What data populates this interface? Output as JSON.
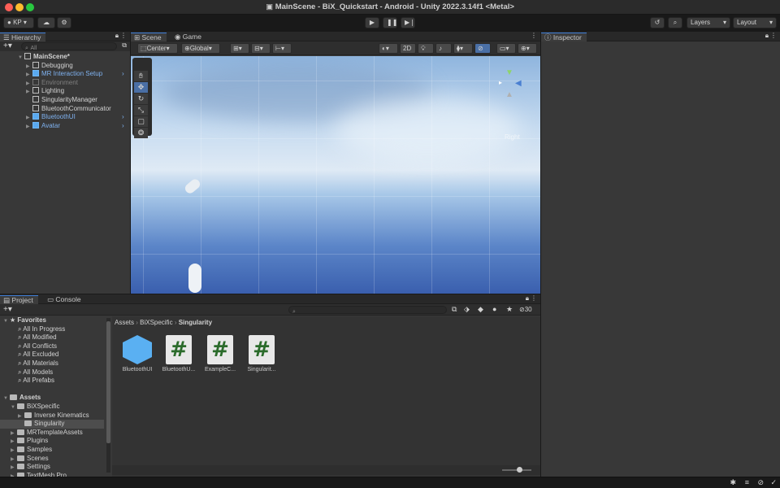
{
  "window": {
    "title": "MainScene - BiX_Quickstart - Android - Unity 2022.3.14f1 <Metal>"
  },
  "toolbar": {
    "account": "KP",
    "account_caret": "▾",
    "layers": "Layers",
    "layout": "Layout",
    "play_icon": "play-icon",
    "pause_icon": "pause-icon",
    "step_icon": "step-icon"
  },
  "hierarchy": {
    "tab_label": "Hierarchy",
    "search_placeholder": "All",
    "items": [
      {
        "label": "MainScene*",
        "indent": 0,
        "style": "root"
      },
      {
        "label": "Debugging",
        "indent": 1,
        "style": "normal"
      },
      {
        "label": "MR Interaction Setup",
        "indent": 1,
        "style": "prefab"
      },
      {
        "label": "Environment",
        "indent": 1,
        "style": "disabled"
      },
      {
        "label": "Lighting",
        "indent": 1,
        "style": "normal"
      },
      {
        "label": "SingularityManager",
        "indent": 1,
        "style": "normal"
      },
      {
        "label": "BluetoothCommunicator",
        "indent": 1,
        "style": "normal"
      },
      {
        "label": "BluetoothUI",
        "indent": 1,
        "style": "prefab"
      },
      {
        "label": "Avatar",
        "indent": 1,
        "style": "prefab"
      }
    ]
  },
  "scene": {
    "tabs": [
      "Scene",
      "Game"
    ],
    "pivot": "Center",
    "space": "Global",
    "mode_2d": "2D",
    "orientation_label": "Right"
  },
  "inspector": {
    "tab_label": "Inspector"
  },
  "project": {
    "tabs": [
      "Project",
      "Console"
    ],
    "hidden_count": "30",
    "favorites_label": "Favorites",
    "favorites": [
      "All In Progress",
      "All Modified",
      "All Conflicts",
      "All Excluded",
      "All Materials",
      "All Models",
      "All Prefabs"
    ],
    "assets_label": "Assets",
    "tree": [
      {
        "label": "BiXSpecific",
        "indent": 1
      },
      {
        "label": "Inverse Kinematics",
        "indent": 2
      },
      {
        "label": "Singularity",
        "indent": 2,
        "selected": true
      },
      {
        "label": "MRTemplateAssets",
        "indent": 1
      },
      {
        "label": "Plugins",
        "indent": 1
      },
      {
        "label": "Samples",
        "indent": 1
      },
      {
        "label": "Scenes",
        "indent": 1
      },
      {
        "label": "Settings",
        "indent": 1
      },
      {
        "label": "TextMesh Pro",
        "indent": 1
      }
    ],
    "breadcrumb": [
      "Assets",
      "BiXSpecific",
      "Singularity"
    ],
    "assets": [
      {
        "name": "BluetoothUI",
        "kind": "prefab"
      },
      {
        "name": "BluetoothU...",
        "kind": "script"
      },
      {
        "name": "ExampleC...",
        "kind": "script"
      },
      {
        "name": "Singularit...",
        "kind": "script"
      }
    ],
    "script_glyph": "#"
  },
  "colors": {
    "accent": "#3e7dd6",
    "prefab_blue": "#7fb2f0",
    "panel": "#383838",
    "sky_top": "#8fb8df"
  }
}
